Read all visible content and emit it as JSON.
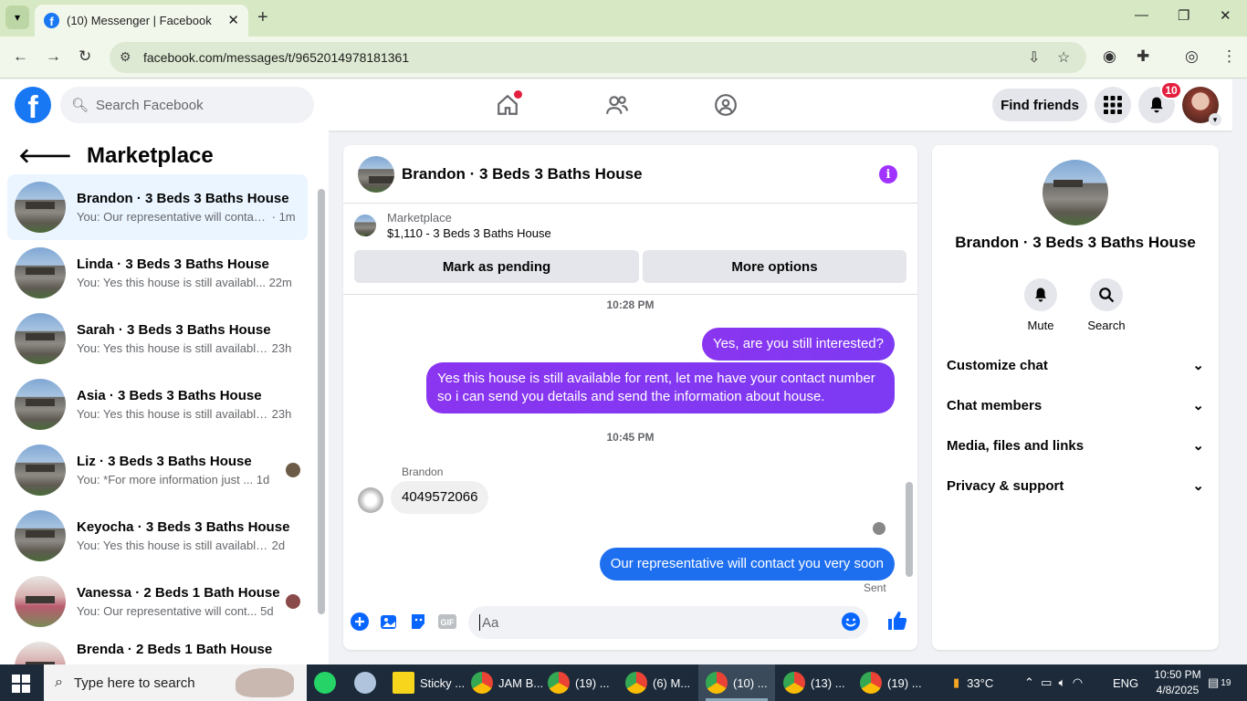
{
  "browser": {
    "tab_title": "(10) Messenger | Facebook",
    "url": "facebook.com/messages/t/9652014978181361"
  },
  "fb_header": {
    "search_placeholder": "Search Facebook",
    "find_friends": "Find friends",
    "notif_count": "10"
  },
  "sidebar": {
    "title": "Marketplace",
    "conversations": [
      {
        "name": "Brandon · 3 Beds 3 Baths House",
        "snippet": "You: Our representative will contac...",
        "time": "· 1m"
      },
      {
        "name": "Linda · 3 Beds 3 Baths House",
        "snippet": "You: Yes this house is still availabl...",
        "time": "22m"
      },
      {
        "name": "Sarah · 3 Beds 3 Baths House",
        "snippet": "You: Yes this house is still available...",
        "time": "23h"
      },
      {
        "name": "Asia · 3 Beds 3 Baths House",
        "snippet": "You: Yes this house is still available...",
        "time": "23h"
      },
      {
        "name": "Liz · 3 Beds 3 Baths House",
        "snippet": "You: *For more information just ...",
        "time": "1d"
      },
      {
        "name": "Keyocha · 3 Beds 3 Baths House",
        "snippet": "You: Yes this house is still available ...",
        "time": "2d"
      },
      {
        "name": "Vanessa · 2 Beds 1 Bath House",
        "snippet": "You: Our representative will cont...",
        "time": "5d"
      },
      {
        "name": "Brenda · 2 Beds 1 Bath House",
        "snippet": "",
        "time": ""
      }
    ]
  },
  "chat": {
    "title": "Brandon · 3 Beds 3 Baths House",
    "marketplace_label": "Marketplace",
    "listing": "$1,110 - 3 Beds 3 Baths House",
    "mark_pending": "Mark as pending",
    "more_options": "More options",
    "ts1": "10:28 PM",
    "msg1": "Yes, are you still interested?",
    "msg2": "Yes this house is still available for rent, let me have your contact number so i can send you details and send the information about house.",
    "ts2": "10:45 PM",
    "sender": "Brandon",
    "msg3": "4049572066",
    "msg4": "Our representative will contact you very soon",
    "status": "Sent",
    "composer_placeholder": "Aa"
  },
  "details": {
    "name": "Brandon · 3 Beds 3 Baths House",
    "mute": "Mute",
    "search": "Search",
    "sections": [
      "Customize chat",
      "Chat members",
      "Media, files and links",
      "Privacy & support"
    ]
  },
  "taskbar": {
    "search_placeholder": "Type here to search",
    "items": [
      "Sticky ...",
      "JAM B...",
      "(19) ...",
      "(6) M...",
      "(10) ...",
      "(13) ...",
      "(19) ..."
    ],
    "temp": "33°C",
    "lang": "ENG",
    "time": "10:50 PM",
    "date": "4/8/2025",
    "notif": "19"
  },
  "colors": {
    "fb_blue": "#1877f2",
    "purple": "#8a35f0",
    "tab_bg": "#d6e8c4"
  }
}
